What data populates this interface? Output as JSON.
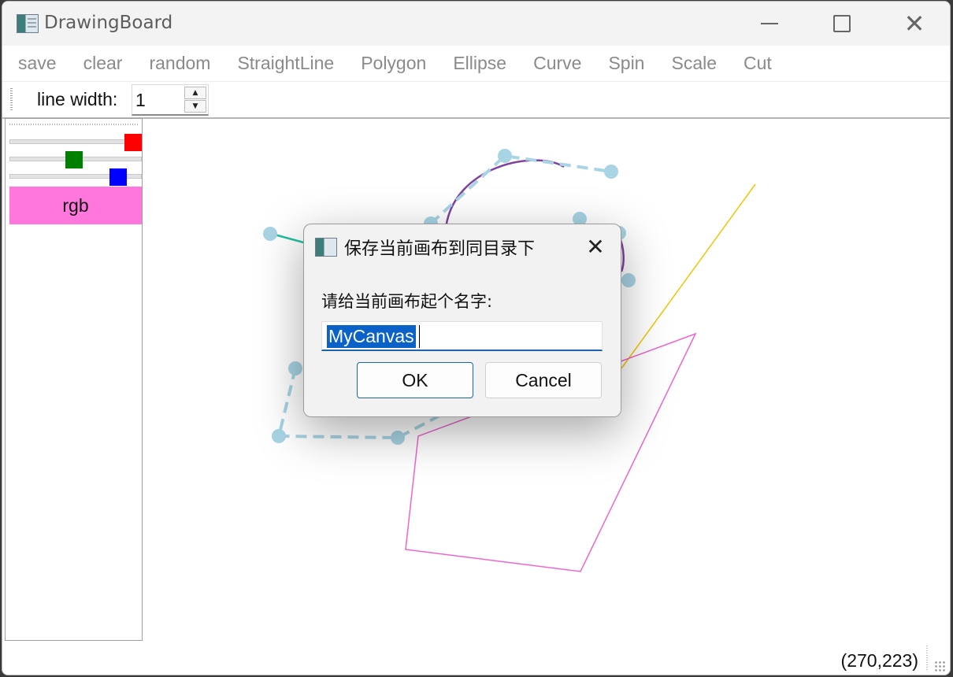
{
  "window": {
    "title": "DrawingBoard",
    "controls": [
      "minimize-icon",
      "maximize-icon",
      "close-icon"
    ]
  },
  "menu": {
    "items": [
      "save",
      "clear",
      "random",
      "StraightLine",
      "Polygon",
      "Ellipse",
      "Curve",
      "Spin",
      "Scale",
      "Cut"
    ]
  },
  "toolbar": {
    "line_width_label": "line width:",
    "line_width_value": "1"
  },
  "side_panel": {
    "sliders": [
      {
        "name": "red",
        "color": "#ff0000",
        "level": 1.0
      },
      {
        "name": "green",
        "color": "#008000",
        "level": 0.5
      },
      {
        "name": "blue",
        "color": "#0000ff",
        "level": 0.85
      }
    ],
    "rgb_button_label": "rgb",
    "rgb_color": "#ff77dd"
  },
  "status": {
    "coords": "(270,223)"
  },
  "dialog": {
    "title": "保存当前画布到同目录下",
    "prompt": "请给当前画布起个名字:",
    "input_value": "MyCanvas",
    "ok_label": "OK",
    "cancel_label": "Cancel"
  }
}
